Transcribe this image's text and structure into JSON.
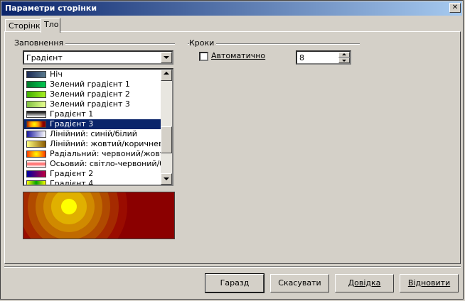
{
  "window": {
    "title": "Параметри сторінки",
    "close_glyph": "✕"
  },
  "tabs": [
    {
      "label": "Сторінка"
    },
    {
      "label": "Тло"
    }
  ],
  "fill": {
    "group_label": "Заповнення",
    "combo_value": "Градієнт",
    "list_items": [
      {
        "label": "Ніч"
      },
      {
        "label": "Зелений градієнт 1"
      },
      {
        "label": "Зелений градієнт 2"
      },
      {
        "label": "Зелений градієнт 3"
      },
      {
        "label": "Градієнт 1"
      },
      {
        "label": "Градієнт 3"
      },
      {
        "label": "Лінійний: синій/білий"
      },
      {
        "label": "Лінійний: жовтий/коричневий"
      },
      {
        "label": "Радіальний: червоний/жовтий"
      },
      {
        "label": "Осьовий: світло-червоний/білий"
      },
      {
        "label": "Градієнт 2"
      },
      {
        "label": "Градієнт 4"
      }
    ],
    "selected_item": "Градієнт 3"
  },
  "steps": {
    "group_label": "Кроки",
    "auto_label": "Автоматично",
    "auto_checked": false,
    "increment_value": "8"
  },
  "buttons": {
    "ok": "Гаразд",
    "cancel": "Скасувати",
    "help": "Довідка",
    "reset": "Відновити"
  }
}
